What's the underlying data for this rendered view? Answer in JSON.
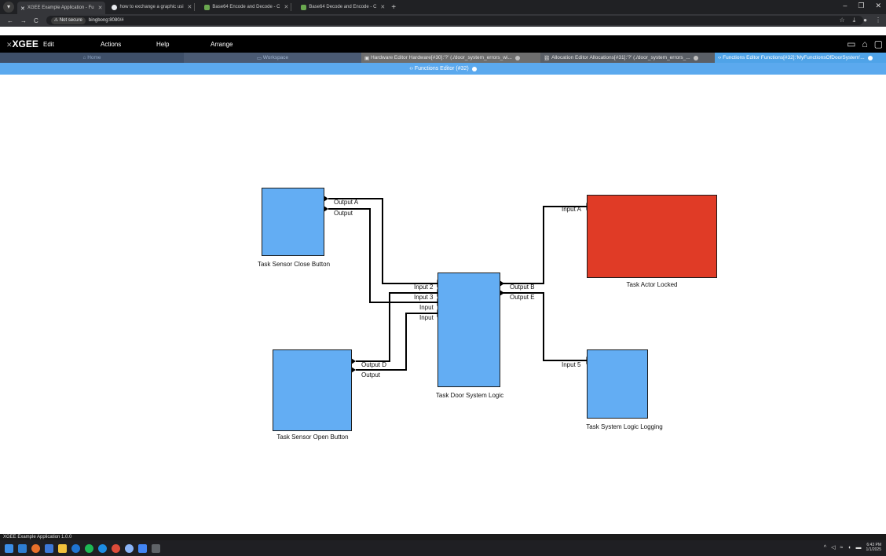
{
  "browser": {
    "tabs": [
      {
        "label": "XGEE Example Application - Fu",
        "active": true
      },
      {
        "label": "how to exchange a graphic usi",
        "active": false
      },
      {
        "label": "Base64 Encode and Decode - C",
        "active": false
      },
      {
        "label": "Base64 Decode and Encode - C",
        "active": false
      }
    ],
    "new_tab": "+",
    "address": {
      "security": "Not secure",
      "url": "bingbong:8080/#"
    }
  },
  "app": {
    "brand": "XGEE",
    "menu": [
      "Edit",
      "Actions",
      "Help",
      "Arrange"
    ],
    "editor_tabs": [
      {
        "label": "Home",
        "icon": "home-icon"
      },
      {
        "label": "Workspace",
        "icon": "folder-icon"
      },
      {
        "label": "Hardware Editor Hardware[#30]:'?' (./door_system_errors_wi...",
        "icon": "chip-icon"
      },
      {
        "label": "Allocation Editor Allocations[#31]:'?' (./door_system_errors_...",
        "icon": "link-icon"
      },
      {
        "label": "Functions Editor Functions[#32]:'MyFunctionsOfDoorSystem'...",
        "icon": "code-icon"
      }
    ],
    "subheader": "Functions Editor (#32)",
    "status": "XGEE Example Application 1.0.0"
  },
  "diagram": {
    "blocks": [
      {
        "id": "close",
        "name": "Task Sensor Close Button",
        "color": "#63adf3"
      },
      {
        "id": "open",
        "name": "Task Sensor Open Button",
        "color": "#63adf3"
      },
      {
        "id": "logic",
        "name": "Task Door System Logic",
        "color": "#63adf3"
      },
      {
        "id": "actor",
        "name": "Task Actor Locked",
        "color": "#e03b26"
      },
      {
        "id": "logging",
        "name": "Task System Logic Logging",
        "color": "#63adf3"
      }
    ],
    "ports": {
      "close_out_a": "Output A",
      "close_out": "Output",
      "open_out_d": "Output D",
      "open_out": "Output",
      "logic_in_2": "Input 2",
      "logic_in_3": "Input 3",
      "logic_in_a": "Input",
      "logic_in_b": "Input",
      "logic_out_b": "Output B",
      "logic_out_e": "Output E",
      "actor_in_a": "Input A",
      "logging_in_5": "Input 5"
    }
  },
  "taskbar": {
    "time": "6:43 PM",
    "date": "1/1/2025"
  }
}
